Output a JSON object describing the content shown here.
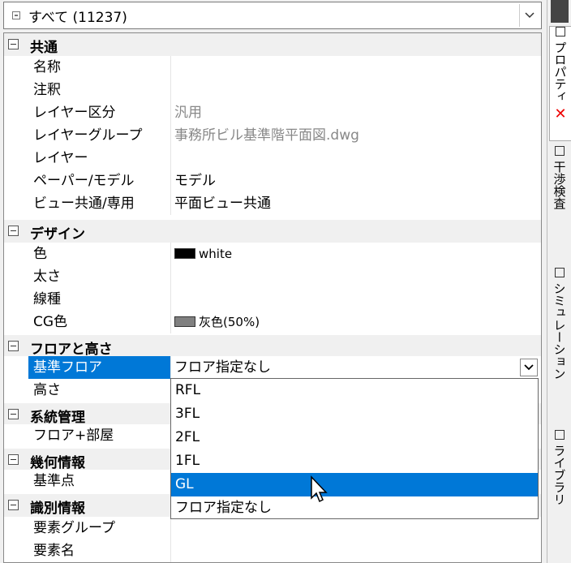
{
  "selector": {
    "label": "すべて (11237)"
  },
  "categories": {
    "common": "共通",
    "design": "デザイン",
    "floor": "フロアと高さ",
    "system": "系統管理",
    "geometry": "幾何情報",
    "id": "識別情報"
  },
  "props": {
    "name": "名称",
    "note": "注釈",
    "layer_class": "レイヤー区分",
    "layer_class_val": "汎用",
    "layer_group": "レイヤーグループ",
    "layer_group_val": "事務所ビル基準階平面図.dwg",
    "layer": "レイヤー",
    "paper_model": "ペーパー/モデル",
    "paper_model_val": "モデル",
    "view": "ビュー共通/専用",
    "view_val": "平面ビュー共通",
    "color": "色",
    "color_val": "white",
    "thickness": "太さ",
    "linetype": "線種",
    "cg_color": "CG色",
    "cg_color_val": "灰色(50%)",
    "base_floor": "基準フロア",
    "base_floor_val": "フロア指定なし",
    "height": "高さ",
    "floor_room": "フロア+部屋",
    "base_point": "基準点",
    "elem_group": "要素グループ",
    "elem_name": "要素名"
  },
  "dropdown": [
    "RFL",
    "3FL",
    "2FL",
    "1FL",
    "GL",
    "フロア指定なし"
  ],
  "colors": {
    "selection": "#0078d7",
    "color_swatch": "#000000",
    "cg_swatch": "#808080"
  },
  "tabs": {
    "properties": "プロパティ",
    "interference": "干渉検査",
    "simulation": "シミュレーション",
    "library": "ライブラリ"
  }
}
